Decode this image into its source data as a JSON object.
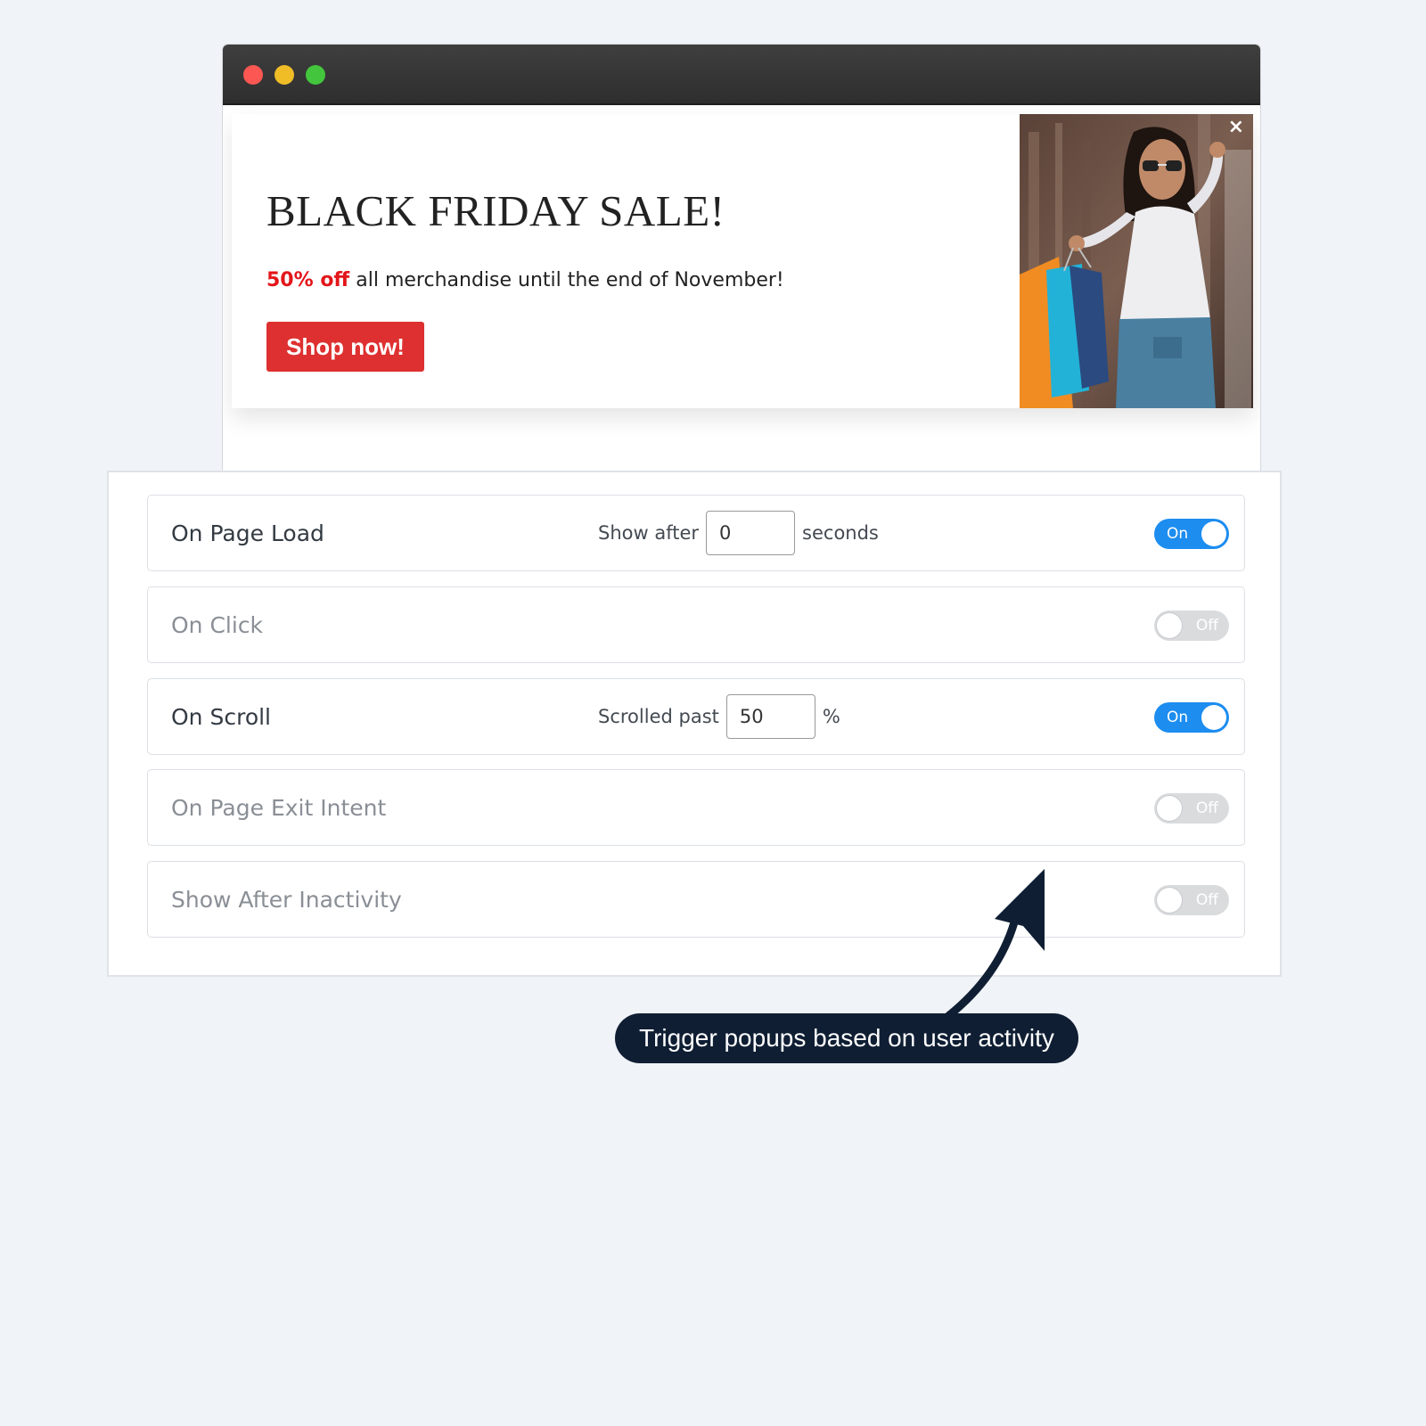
{
  "popup": {
    "title": "BLACK FRIDAY SALE!",
    "highlight": "50% off",
    "text": " all merchandise until the end of November!",
    "button_label": "Shop now!",
    "close_label": "×"
  },
  "triggers": [
    {
      "label": "On Page Load",
      "state": "On",
      "enabled": true,
      "prefix": "Show after",
      "value": "0",
      "suffix": "seconds"
    },
    {
      "label": "On Click",
      "state": "Off",
      "enabled": false
    },
    {
      "label": "On Scroll",
      "state": "On",
      "enabled": true,
      "prefix": "Scrolled past",
      "value": "50",
      "suffix": "%"
    },
    {
      "label": "On Page Exit Intent",
      "state": "Off",
      "enabled": false
    },
    {
      "label": "Show After Inactivity",
      "state": "Off",
      "enabled": false
    }
  ],
  "annotation": {
    "text": "Trigger popups based on user activity"
  },
  "colors": {
    "accent": "#1d8df0",
    "sale_red": "#de3030",
    "callout_bg": "#0f1e33"
  }
}
